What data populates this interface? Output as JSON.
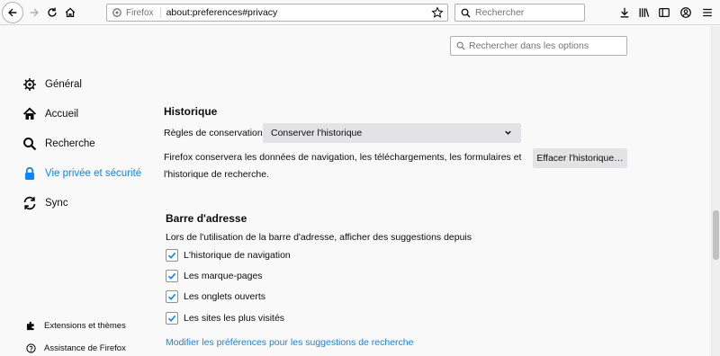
{
  "toolbar": {
    "identity_label": "Firefox",
    "url": "about:preferences#privacy",
    "search_placeholder": "Rechercher"
  },
  "options_search": {
    "placeholder": "Rechercher dans les options"
  },
  "sidebar": {
    "items": [
      {
        "label": "Général",
        "icon": "gear-icon"
      },
      {
        "label": "Accueil",
        "icon": "home-icon"
      },
      {
        "label": "Recherche",
        "icon": "search-icon"
      },
      {
        "label": "Vie privée et sécurité",
        "icon": "lock-icon",
        "active": true
      },
      {
        "label": "Sync",
        "icon": "sync-icon"
      }
    ],
    "footer": [
      {
        "label": "Extensions et thèmes",
        "icon": "puzzle-icon"
      },
      {
        "label": "Assistance de Firefox",
        "icon": "help-icon"
      }
    ]
  },
  "history": {
    "title": "Historique",
    "rule_label": "Règles de conservation",
    "rule_value": "Conserver l'historique",
    "description_line1": "Firefox conservera les données de navigation, les téléchargements, les formulaires et",
    "description_line2": "l'historique de recherche.",
    "clear_button": "Effacer l'historique…"
  },
  "address_bar": {
    "title": "Barre d'adresse",
    "description": "Lors de l'utilisation de la barre d'adresse, afficher des suggestions depuis",
    "options": [
      {
        "label": "L'historique de navigation",
        "checked": true
      },
      {
        "label": "Les marque-pages",
        "checked": true
      },
      {
        "label": "Les onglets ouverts",
        "checked": true
      },
      {
        "label": "Les sites les plus visités",
        "checked": true
      }
    ],
    "link": "Modifier les préférences pour les suggestions de recherche"
  },
  "colors": {
    "accent": "#0a84ff",
    "background": "#f9f9fa"
  }
}
